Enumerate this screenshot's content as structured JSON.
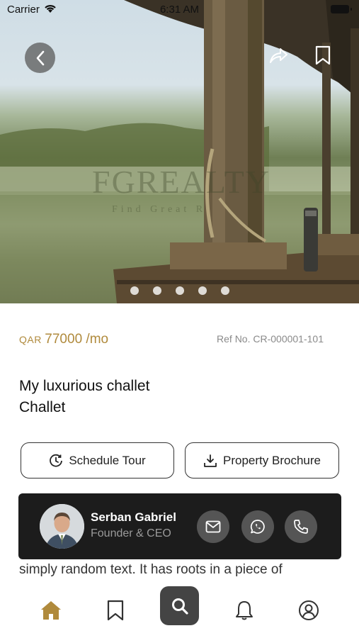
{
  "status_bar": {
    "carrier": "Carrier",
    "time": "6:31 AM"
  },
  "hero": {
    "watermark_main": "FGREALTY",
    "watermark_sub": "Find Great R",
    "slide_count": 5
  },
  "listing": {
    "currency": "QAR",
    "price": "77000 /mo",
    "ref": "Ref No. CR-000001-101",
    "title_line1": "My luxurious challet",
    "title_line2": "Challet"
  },
  "actions": {
    "schedule_label": "Schedule Tour",
    "brochure_label": "Property Brochure"
  },
  "description_peek": "simply random text. It has roots in a piece of",
  "agent": {
    "name": "Serban Gabriel",
    "role": "Founder & CEO"
  },
  "colors": {
    "accent_gold": "#b08a3c",
    "card_dark": "#1c1c1c",
    "nav_search_bg": "#444444"
  },
  "icons": {
    "back": "chevron-left-icon",
    "share": "share-icon",
    "bookmark": "bookmark-icon",
    "schedule": "clock-icon",
    "download": "download-icon",
    "mail": "mail-icon",
    "whatsapp": "whatsapp-icon",
    "phone": "phone-icon",
    "home": "home-icon",
    "saved": "bookmark-icon",
    "search": "search-icon",
    "notifications": "bell-icon",
    "profile": "user-icon"
  }
}
